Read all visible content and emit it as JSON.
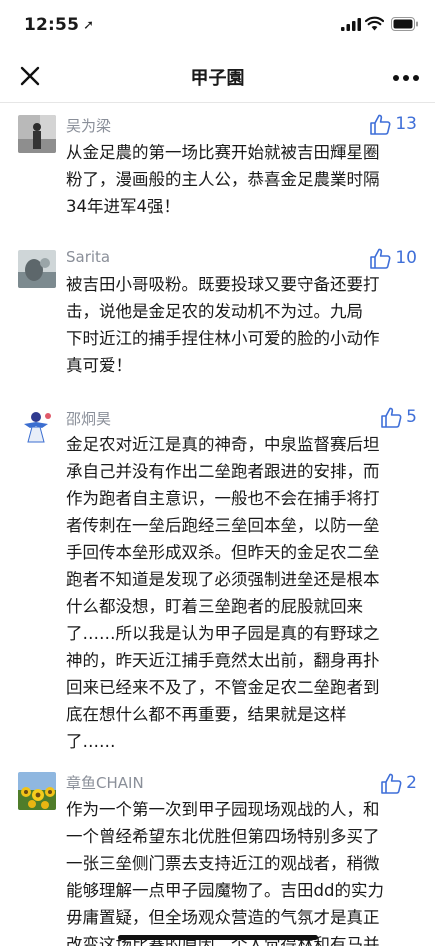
{
  "status_bar": {
    "time": "12:55"
  },
  "header": {
    "title": "甲子園"
  },
  "comments": [
    {
      "username": "吴为梁",
      "likes": "13",
      "text": "从金足農的第一场比赛开始就被吉田輝星圈\n粉了，漫画般的主人公，恭喜金足農業时隔\n34年进军4强！"
    },
    {
      "username": "Sarita",
      "likes": "10",
      "text": "被吉田小哥吸粉。既要投球又要守备还要打\n击，说他是金足农的发动机不为过。九局\n下时近江的捕手捏住林小可爱的脸的小动作\n真可爱！"
    },
    {
      "username": "邵炯昊",
      "likes": "5",
      "text": "金足农对近江是真的神奇，中泉监督赛后坦\n承自己并没有作出二垒跑者跟进的安排，而\n作为跑者自主意识，一般也不会在捕手将打\n者传刺在一垒后跑经三垒回本垒，以防一垒\n手回传本垒形成双杀。但昨天的金足农二垒\n跑者不知道是发现了必须强制进垒还是根本\n什么都没想，盯着三垒跑者的屁股就回来\n了……所以我是认为甲子园是真的有野球之\n神的，昨天近江捕手竟然太出前，翻身再扑\n回来已经来不及了，不管金足农二垒跑者到\n底在想什么都不再重要，结果就是这样\n了……"
    },
    {
      "username": "章鱼CHAIN",
      "likes": "2",
      "text": "作为一个第一次到甲子园现场观战的人，和\n一个曾经希望东北优胜但第四场特别多买了\n一张三垒侧门票去支持近江的观战者，稍微\n能够理解一点甲子园魔物了。吉田dd的实力\n毋庸置疑，但全场观众营造的气氛才是真正\n改变这场比赛的原因。个人觉得林和有马并"
    }
  ],
  "colors": {
    "accent": "#3f6fd8",
    "meta": "#8a8f99"
  }
}
